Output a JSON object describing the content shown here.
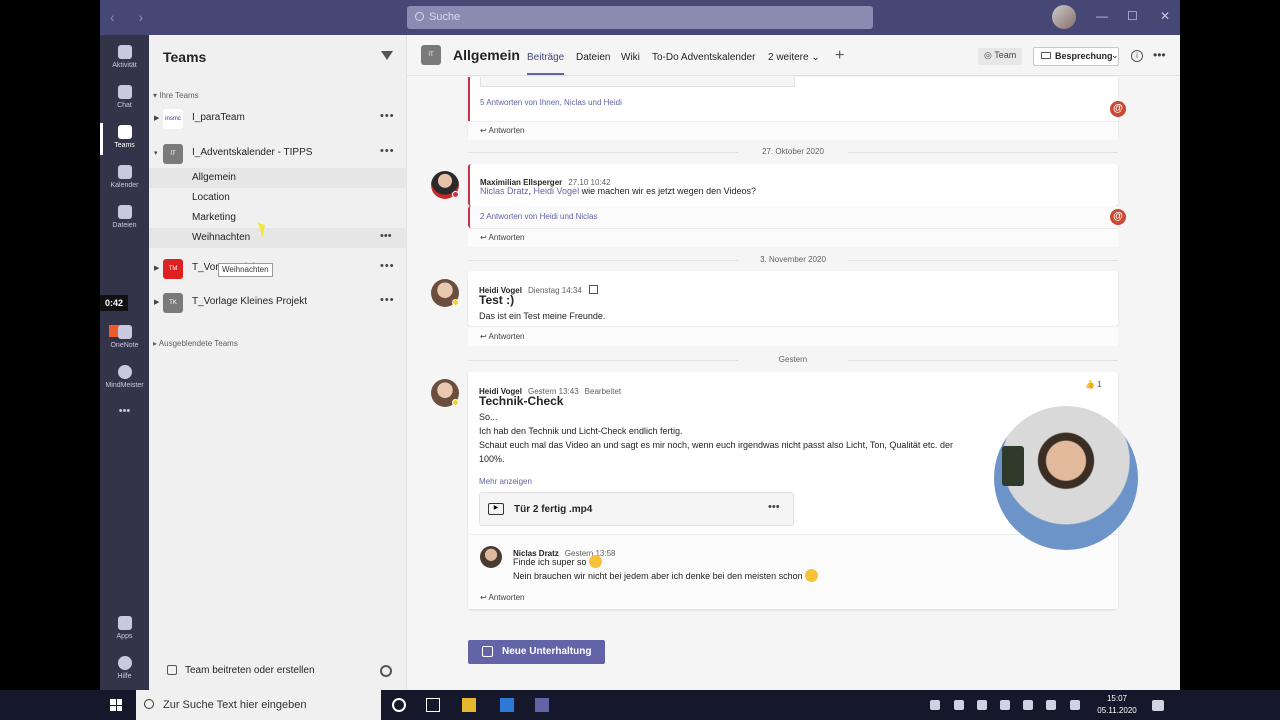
{
  "titlebar": {
    "search_placeholder": "Suche",
    "nav": "‹ ›",
    "minimize": "—",
    "maximize": "☐",
    "close": "✕"
  },
  "rail": {
    "items": [
      {
        "label": "Aktivität"
      },
      {
        "label": "Chat"
      },
      {
        "label": "Teams"
      },
      {
        "label": "Kalender"
      },
      {
        "label": "Dateien"
      },
      {
        "label": "OneNote"
      },
      {
        "label": "MindMeister"
      },
      {
        "label": "Apps"
      },
      {
        "label": "Hilfe"
      }
    ],
    "more": "•••",
    "timer": "0:42"
  },
  "teams_panel": {
    "title": "Teams",
    "section_yours": "Ihre Teams",
    "section_hidden": "Ausgeblendete Teams",
    "teams": [
      {
        "name": "I_paraTeam",
        "avatar": "insmc",
        "color": "#ffffff"
      },
      {
        "name": "I_Adventskalender - TIPPS",
        "avatar": "IT",
        "color": "#7a7a7a"
      },
      {
        "name": "T_Vor s Projekt",
        "avatar": "TM",
        "color": "#e02020"
      },
      {
        "name": "T_Vorlage Kleines Projekt",
        "avatar": "TK",
        "color": "#7a7a7a"
      }
    ],
    "channels": [
      "Allgemein",
      "Location",
      "Marketing",
      "Weihnachten"
    ],
    "tooltip": "Weihnachten",
    "join": "Team beitreten oder erstellen",
    "more": "•••"
  },
  "header": {
    "avatar": "IT",
    "channel": "Allgemein",
    "tabs": [
      "Beiträge",
      "Dateien",
      "Wiki",
      "To-Do Adventskalender",
      "2 weitere ⌄"
    ],
    "plus": "+",
    "team_label": "◎ Team",
    "meet_label": "Besprechung",
    "meet_dropdown": "⌄",
    "info": "i",
    "more": "•••"
  },
  "feed": {
    "top_replies": "5 Antworten von Ihnen, Niclas und Heidi",
    "reply_label": "Antworten",
    "date1": "27. Oktober 2020",
    "post1": {
      "sender": "Maximilian Ellsperger",
      "time": "27.10 10:42",
      "mention1": "Niclas Dratz",
      "sep": ", ",
      "mention2": "Heidi Vogel",
      "text": " wie machen wir es jetzt wegen den Videos?",
      "replies": "2 Antworten von Heidi und Niclas"
    },
    "date2": "3. November 2020",
    "post2": {
      "sender": "Heidi Vogel",
      "time": "Dienstag 14:34",
      "subject": "Test :)",
      "text": "Das ist ein Test meine Freunde."
    },
    "date3": "Gestern",
    "post3": {
      "sender": "Heidi Vogel",
      "time": "Gestern 13:43",
      "edited": "Bearbeitet",
      "likes": "👍 1",
      "subject": "Technik-Check",
      "lines": [
        "So...",
        "Ich hab den Technik und Licht-Check endlich fertig.",
        "Schaut euch mal das Video an und sagt es mir noch, wenn euch irgendwas nicht passt also Licht, Ton, Qualität etc. der",
        "100%."
      ],
      "more": "Mehr anzeigen",
      "file": "Tür 2 fertig .mp4",
      "file_more": "•••"
    },
    "reply3": {
      "sender": "Niclas Dratz",
      "time": "Gestern 13:58",
      "line1": "Finde ich super so",
      "line2": "Nein brauchen wir nicht bei jedem aber ich denke bei den meisten schon"
    },
    "mention_mark": "@",
    "new_conversation": "Neue Unterhaltung"
  },
  "taskbar": {
    "search": "Zur Suche Text hier eingeben",
    "time": "15:07",
    "date": "05.11.2020"
  }
}
